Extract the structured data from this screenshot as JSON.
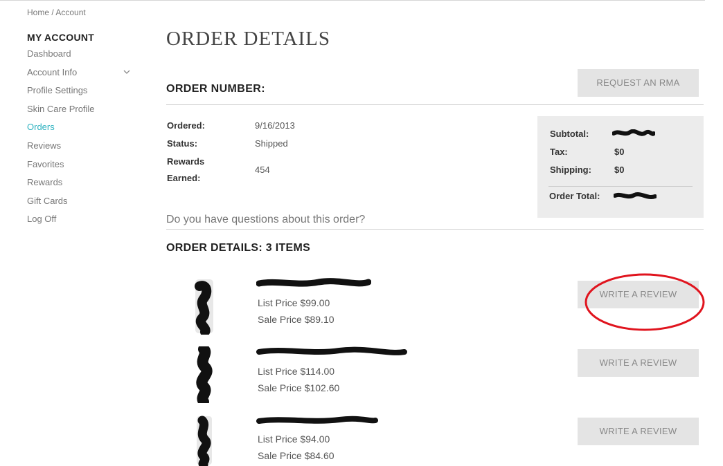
{
  "breadcrumb": {
    "home": "Home",
    "separator": " / ",
    "current": "Account"
  },
  "sidebar": {
    "title": "MY ACCOUNT",
    "items": [
      {
        "label": "Dashboard"
      },
      {
        "label": "Account Info"
      },
      {
        "label": "Profile Settings"
      },
      {
        "label": "Skin Care Profile"
      },
      {
        "label": "Orders"
      },
      {
        "label": "Reviews"
      },
      {
        "label": "Favorites"
      },
      {
        "label": "Rewards"
      },
      {
        "label": "Gift Cards"
      },
      {
        "label": "Log Off"
      }
    ],
    "active_color": "#2eb2c0"
  },
  "page_title": "ORDER DETAILS",
  "order": {
    "number_label": "ORDER NUMBER:",
    "rma_button": "REQUEST AN RMA",
    "ordered_label": "Ordered:",
    "ordered_value": "9/16/2013",
    "status_label": "Status:",
    "status_value": "Shipped",
    "rewards_label_1": "Rewards",
    "rewards_label_2": "Earned:",
    "rewards_value": "454"
  },
  "summary": {
    "subtotal_label": "Subtotal:",
    "tax_label": "Tax:",
    "tax_value": "$0",
    "shipping_label": "Shipping:",
    "shipping_value": "$0",
    "total_label": "Order Total:"
  },
  "question_link": "Do you have questions about this order?",
  "details_heading": "ORDER DETAILS: 3 ITEMS",
  "items": [
    {
      "list_price": "List Price $99.00",
      "sale_price": "Sale Price $89.10",
      "review_button": "WRITE A REVIEW"
    },
    {
      "list_price": "List Price $114.00",
      "sale_price": "Sale Price $102.60",
      "review_button": "WRITE A REVIEW"
    },
    {
      "list_price": "List Price $94.00",
      "sale_price": "Sale Price $84.60",
      "review_button": "WRITE A REVIEW"
    }
  ],
  "annotation_color": "#e0141e"
}
